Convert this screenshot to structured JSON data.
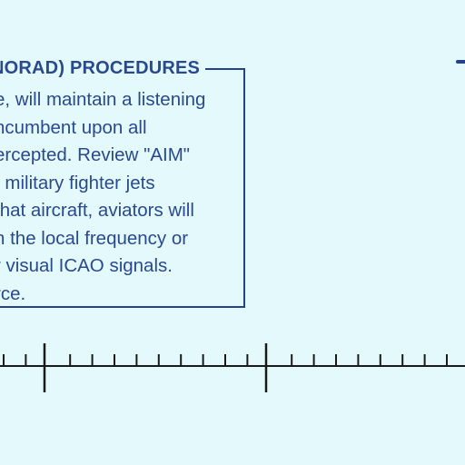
{
  "notice": {
    "title": "NORAD) PROCEDURES",
    "lines": [
      "e, will maintain a listening",
      "ncumbent upon all",
      "ercepted. Review \"AIM\"",
      ". military fighter jets",
      "that aircraft, aviators will",
      "n the local frequency or",
      "r visual ICAO signals.",
      "rce."
    ]
  },
  "colors": {
    "background": "#e4f9fb",
    "ink": "#2a4a8e",
    "scale_ink": "#1a1a1a"
  },
  "scale_bar": {
    "major_tick_count": 2,
    "minor_tick_count": 20
  }
}
